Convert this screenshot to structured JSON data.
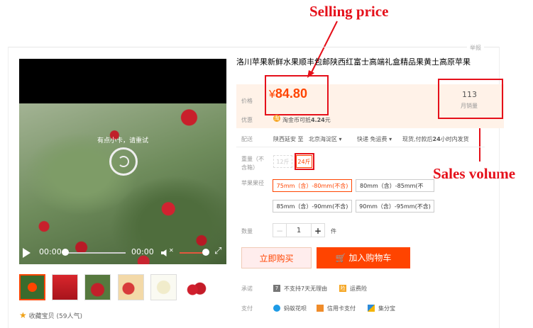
{
  "annotations": {
    "selling_price": "Selling price",
    "sales_volume": "Sales volume"
  },
  "report_link": "举报",
  "video": {
    "overlay_message": "有点小卡，请重试",
    "current_time": "00:00",
    "duration": "00:00"
  },
  "favorite": {
    "label": "收藏宝贝",
    "count": "(59人气)"
  },
  "product": {
    "title": "洛川苹果新鲜水果顺丰包邮陕西红富士高端礼盒精品果黄土高原苹果"
  },
  "price": {
    "label": "价格",
    "currency": "¥",
    "value": "84.80"
  },
  "sales": {
    "count": "113",
    "label": "月销量"
  },
  "promo": {
    "label": "优惠",
    "coin_icon_text": "淘",
    "text_prefix": "淘金币可抵",
    "amount": "4.24",
    "suffix": "元"
  },
  "delivery": {
    "label": "配送",
    "from": "陕西延安 至",
    "to": "北京海淀区",
    "method": "快递 免运费",
    "note_prefix": "现货,付款后",
    "note_bold": "24",
    "note_suffix": "小时内发货"
  },
  "weight": {
    "label_line1": "重量（不",
    "label_line2": "含箱）",
    "options": [
      "12斤",
      "24斤"
    ]
  },
  "diameter": {
    "label": "苹果果径",
    "options": [
      "75mm（含）-80mm(不含)",
      "80mm（含）-85mm(不",
      "85mm（含）-90mm(不含)",
      "90mm（含）-95mm(不含)"
    ]
  },
  "quantity": {
    "label": "数量",
    "value": "1",
    "unit": "件",
    "minus": "−",
    "plus": "+"
  },
  "buttons": {
    "buy_now": "立即购买",
    "add_to_cart": "加入购物车"
  },
  "promise": {
    "label": "承诺",
    "items": [
      {
        "icon": "7",
        "text": "不支持7天无理由"
      },
      {
        "icon": "险",
        "text": "运费险"
      }
    ]
  },
  "payment": {
    "label": "支付",
    "methods": [
      "蚂蚁花呗",
      "信用卡支付",
      "集分宝"
    ]
  },
  "colors": {
    "accent": "#ff4400",
    "annotation": "#e5101a",
    "price_bg": "#fff2e8"
  }
}
